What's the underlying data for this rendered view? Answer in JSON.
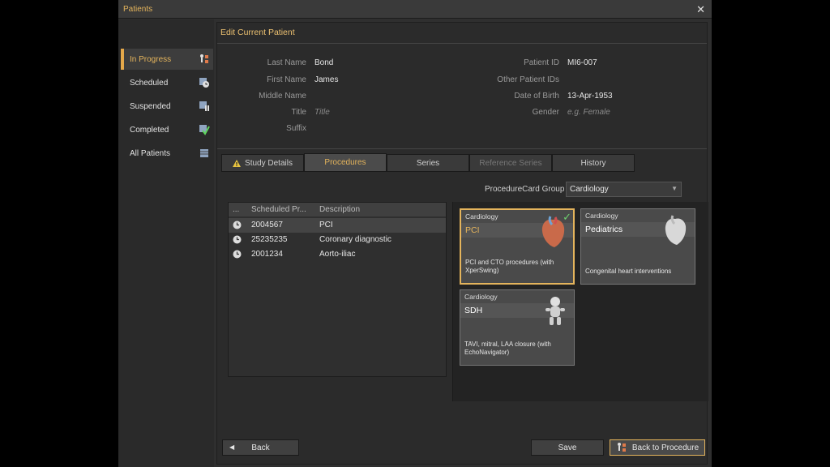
{
  "window": {
    "title": "Patients",
    "close_icon": "close-icon"
  },
  "sidebar": {
    "items": [
      {
        "label": "In Progress",
        "icon": "in-progress-icon",
        "active": true
      },
      {
        "label": "Scheduled",
        "icon": "scheduled-icon"
      },
      {
        "label": "Suspended",
        "icon": "suspended-icon"
      },
      {
        "label": "Completed",
        "icon": "completed-icon"
      },
      {
        "label": "All Patients",
        "icon": "all-patients-icon"
      }
    ]
  },
  "header": {
    "title": "Edit Current Patient"
  },
  "form": {
    "last_name": {
      "label": "Last Name",
      "value": "Bond"
    },
    "first_name": {
      "label": "First Name",
      "value": "James"
    },
    "middle_name": {
      "label": "Middle Name",
      "value": ""
    },
    "title": {
      "label": "Title",
      "placeholder": "Title"
    },
    "suffix": {
      "label": "Suffix",
      "value": ""
    },
    "patient_id": {
      "label": "Patient ID",
      "value": "MI6-007"
    },
    "other_ids": {
      "label": "Other Patient IDs",
      "value": ""
    },
    "dob": {
      "label": "Date of Birth",
      "value": "13-Apr-1953"
    },
    "gender": {
      "label": "Gender",
      "placeholder": "e.g. Female"
    }
  },
  "tabs": [
    {
      "label": "Study Details",
      "icon": "warning-icon"
    },
    {
      "label": "Procedures",
      "active": true
    },
    {
      "label": "Series"
    },
    {
      "label": "Reference Series",
      "disabled": true
    },
    {
      "label": "History"
    }
  ],
  "procedure_card_group": {
    "label": "ProcedureCard Group",
    "value": "Cardiology"
  },
  "procedures_table": {
    "columns": [
      "...",
      "Scheduled Pr...",
      "Description"
    ],
    "rows": [
      {
        "code": "2004567",
        "description": "PCI"
      },
      {
        "code": "25235235",
        "description": "Coronary diagnostic"
      },
      {
        "code": "2001234",
        "description": "Aorto-iliac"
      }
    ]
  },
  "cards": [
    {
      "group": "Cardiology",
      "name": "PCI",
      "description": "PCI and CTO procedures (with XperSwing)",
      "icon": "heart-icon",
      "selected": true
    },
    {
      "group": "Cardiology",
      "name": "Pediatrics",
      "description": "Congenital heart interventions",
      "icon": "heart-icon"
    },
    {
      "group": "Cardiology",
      "name": "SDH",
      "description": "TAVI, mitral, LAA closure (with EchoNavigator)",
      "icon": "baby-icon"
    }
  ],
  "buttons": {
    "back": "Back",
    "save": "Save",
    "back_to_procedure": "Back to Procedure"
  },
  "colors": {
    "accent": "#e4b45c",
    "background": "#2f2f2f",
    "check": "#6fd26f"
  }
}
